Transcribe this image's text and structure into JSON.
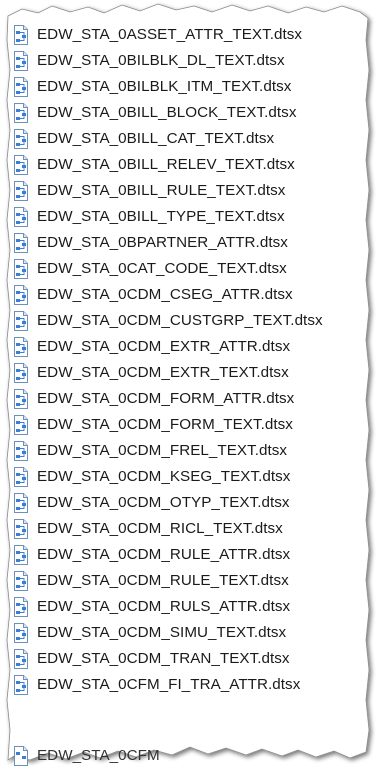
{
  "files": [
    {
      "name": "EDW_STA_0ASSET_ATTR_TEXT.dtsx",
      "icon": "dtsx-file-icon"
    },
    {
      "name": "EDW_STA_0BILBLK_DL_TEXT.dtsx",
      "icon": "dtsx-file-icon"
    },
    {
      "name": "EDW_STA_0BILBLK_ITM_TEXT.dtsx",
      "icon": "dtsx-file-icon"
    },
    {
      "name": "EDW_STA_0BILL_BLOCK_TEXT.dtsx",
      "icon": "dtsx-file-icon"
    },
    {
      "name": "EDW_STA_0BILL_CAT_TEXT.dtsx",
      "icon": "dtsx-file-icon"
    },
    {
      "name": "EDW_STA_0BILL_RELEV_TEXT.dtsx",
      "icon": "dtsx-file-icon"
    },
    {
      "name": "EDW_STA_0BILL_RULE_TEXT.dtsx",
      "icon": "dtsx-file-icon"
    },
    {
      "name": "EDW_STA_0BILL_TYPE_TEXT.dtsx",
      "icon": "dtsx-file-icon"
    },
    {
      "name": "EDW_STA_0BPARTNER_ATTR.dtsx",
      "icon": "dtsx-file-icon"
    },
    {
      "name": "EDW_STA_0CAT_CODE_TEXT.dtsx",
      "icon": "dtsx-file-icon"
    },
    {
      "name": "EDW_STA_0CDM_CSEG_ATTR.dtsx",
      "icon": "dtsx-file-icon"
    },
    {
      "name": "EDW_STA_0CDM_CUSTGRP_TEXT.dtsx",
      "icon": "dtsx-file-icon"
    },
    {
      "name": "EDW_STA_0CDM_EXTR_ATTR.dtsx",
      "icon": "dtsx-file-icon"
    },
    {
      "name": "EDW_STA_0CDM_EXTR_TEXT.dtsx",
      "icon": "dtsx-file-icon"
    },
    {
      "name": "EDW_STA_0CDM_FORM_ATTR.dtsx",
      "icon": "dtsx-file-icon"
    },
    {
      "name": "EDW_STA_0CDM_FORM_TEXT.dtsx",
      "icon": "dtsx-file-icon"
    },
    {
      "name": "EDW_STA_0CDM_FREL_TEXT.dtsx",
      "icon": "dtsx-file-icon"
    },
    {
      "name": "EDW_STA_0CDM_KSEG_TEXT.dtsx",
      "icon": "dtsx-file-icon"
    },
    {
      "name": "EDW_STA_0CDM_OTYP_TEXT.dtsx",
      "icon": "dtsx-file-icon"
    },
    {
      "name": "EDW_STA_0CDM_RICL_TEXT.dtsx",
      "icon": "dtsx-file-icon"
    },
    {
      "name": "EDW_STA_0CDM_RULE_ATTR.dtsx",
      "icon": "dtsx-file-icon"
    },
    {
      "name": "EDW_STA_0CDM_RULE_TEXT.dtsx",
      "icon": "dtsx-file-icon"
    },
    {
      "name": "EDW_STA_0CDM_RULS_ATTR.dtsx",
      "icon": "dtsx-file-icon"
    },
    {
      "name": "EDW_STA_0CDM_SIMU_TEXT.dtsx",
      "icon": "dtsx-file-icon"
    },
    {
      "name": "EDW_STA_0CDM_TRAN_TEXT.dtsx",
      "icon": "dtsx-file-icon"
    },
    {
      "name": "EDW_STA_0CFM_FI_TRA_ATTR.dtsx",
      "icon": "dtsx-file-icon"
    }
  ],
  "partial_file": {
    "name": "EDW_STA_0CFM",
    "icon": "dtsx-file-icon"
  },
  "colors": {
    "text": "#1a1a1a",
    "icon_blue": "#3a7fd5",
    "icon_light": "#dbe9fa",
    "shadow": "#b8b8b8"
  }
}
